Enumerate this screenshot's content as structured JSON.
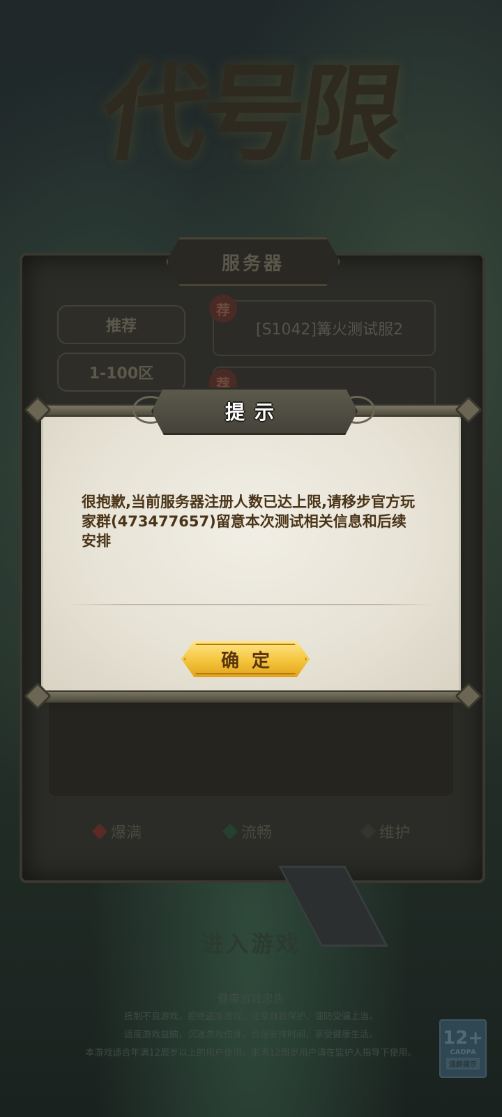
{
  "game": {
    "logo_text": "代号限"
  },
  "server_panel": {
    "title": "服务器",
    "tabs": [
      {
        "label": "推荐"
      },
      {
        "label": "1-100区"
      }
    ],
    "servers": [
      {
        "badge": "荐",
        "name": "[S1042]篝火测试服2"
      },
      {
        "badge": "荐",
        "name": ""
      }
    ],
    "legend": [
      {
        "label": "爆满",
        "color": "#6b2a24"
      },
      {
        "label": "流畅",
        "color": "#2b4f3a"
      },
      {
        "label": "维护",
        "color": "#3a3a36"
      }
    ]
  },
  "enter_button": {
    "label": "进入游戏"
  },
  "health_notice": {
    "title": "健康游戏忠告",
    "lines": [
      "抵制不良游戏，拒绝盗版游戏。注意自我保护，谨防受骗上当。",
      "适度游戏益脑，沉迷游戏伤身。合理安排时间，享受健康生活。",
      "本游戏适合年满12周岁以上的用户使用，未满12周岁用户请在监护人指导下使用。"
    ]
  },
  "age_rating": {
    "age": "12+",
    "org": "CADPA",
    "tip": "适龄提示"
  },
  "dialog": {
    "title": "提示",
    "message": "很抱歉,当前服务器注册人数已达上限,请移步官方玩家群(473477657)留意本次测试相关信息和后续安排",
    "confirm_label": "确定"
  }
}
